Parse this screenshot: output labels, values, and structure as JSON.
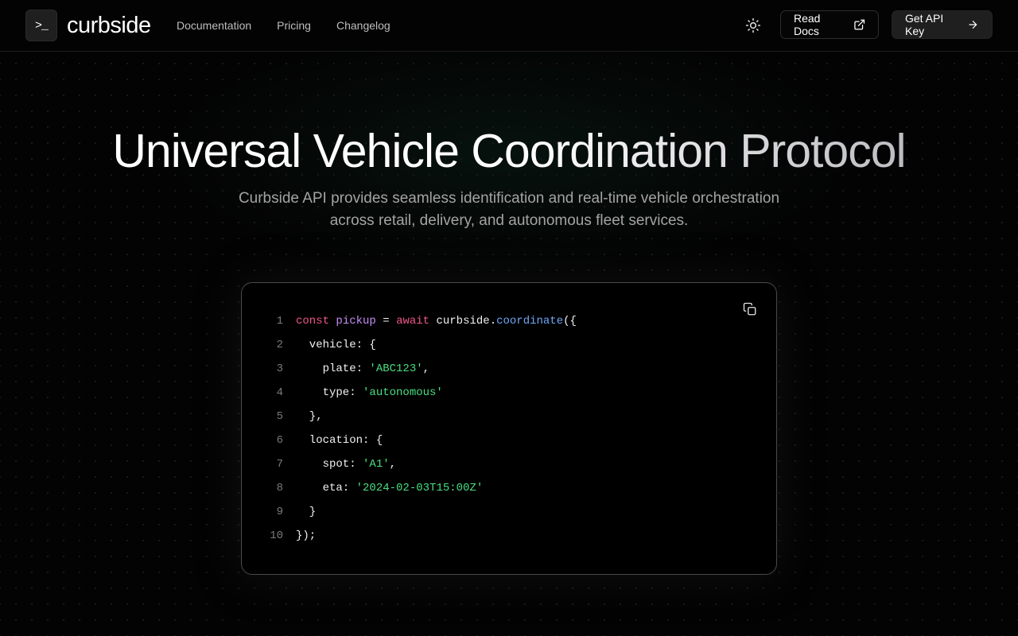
{
  "brand": {
    "logo_glyph": ">_",
    "name": "curbside"
  },
  "nav": [
    {
      "label": "Documentation"
    },
    {
      "label": "Pricing"
    },
    {
      "label": "Changelog"
    }
  ],
  "actions": {
    "theme_icon": "sun-icon",
    "read_docs": "Read Docs",
    "read_docs_icon": "external-link-icon",
    "get_api_key": "Get API Key",
    "get_api_key_icon": "arrow-right-icon"
  },
  "hero": {
    "title": "Universal Vehicle Coordination Protocol",
    "subtitle": "Curbside API provides seamless identification and real-time vehicle orchestration across retail, delivery, and autonomous fleet services."
  },
  "code_example": {
    "copy_icon": "copy-icon",
    "lines": [
      {
        "n": "1",
        "tokens": [
          [
            "kw",
            "const"
          ],
          [
            "plain",
            " "
          ],
          [
            "var",
            "pickup"
          ],
          [
            "plain",
            " = "
          ],
          [
            "kw",
            "await"
          ],
          [
            "plain",
            " curbside."
          ],
          [
            "fn",
            "coordinate"
          ],
          [
            "plain",
            "({"
          ]
        ]
      },
      {
        "n": "2",
        "tokens": [
          [
            "plain",
            "  vehicle: {"
          ]
        ]
      },
      {
        "n": "3",
        "tokens": [
          [
            "plain",
            "    plate: "
          ],
          [
            "str",
            "'ABC123'"
          ],
          [
            "plain",
            ","
          ]
        ]
      },
      {
        "n": "4",
        "tokens": [
          [
            "plain",
            "    type: "
          ],
          [
            "str",
            "'autonomous'"
          ]
        ]
      },
      {
        "n": "5",
        "tokens": [
          [
            "plain",
            "  },"
          ]
        ]
      },
      {
        "n": "6",
        "tokens": [
          [
            "plain",
            "  location: {"
          ]
        ]
      },
      {
        "n": "7",
        "tokens": [
          [
            "plain",
            "    spot: "
          ],
          [
            "str",
            "'A1'"
          ],
          [
            "plain",
            ","
          ]
        ]
      },
      {
        "n": "8",
        "tokens": [
          [
            "plain",
            "    eta: "
          ],
          [
            "str",
            "'2024-02-03T15:00Z'"
          ]
        ]
      },
      {
        "n": "9",
        "tokens": [
          [
            "plain",
            "  }"
          ]
        ]
      },
      {
        "n": "10",
        "tokens": [
          [
            "plain",
            "});"
          ]
        ]
      }
    ]
  },
  "colors": {
    "keyword": "#f0568c",
    "variable": "#c48ef5",
    "function": "#6ea8f7",
    "string": "#4ade80",
    "background": "#030303"
  }
}
